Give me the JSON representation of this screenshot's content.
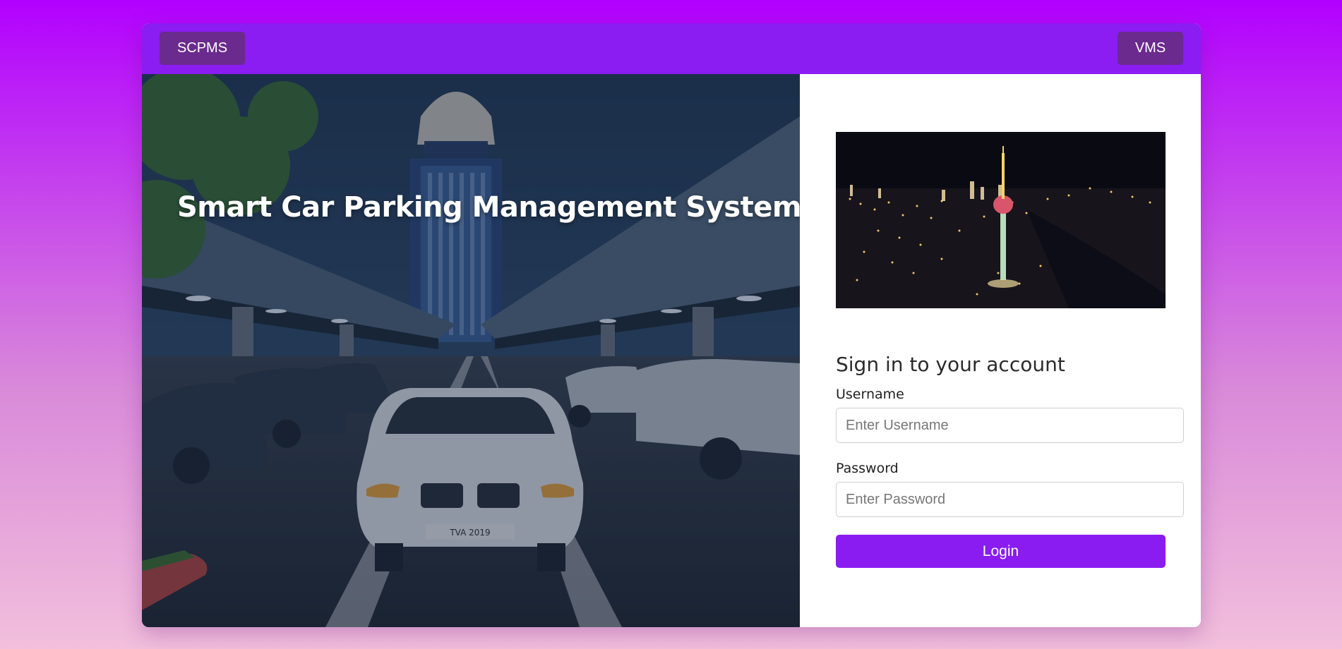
{
  "header": {
    "left_button": "SCPMS",
    "right_button": "VMS"
  },
  "hero": {
    "title": "Smart Car Parking Management System",
    "license_plate": "TVA 2019"
  },
  "login": {
    "title": "Sign in to your account",
    "username_label": "Username",
    "username_placeholder": "Enter Username",
    "username_value": "",
    "password_label": "Password",
    "password_placeholder": "Enter Password",
    "password_value": "",
    "submit_label": "Login"
  },
  "colors": {
    "page_gradient_top": "#b200ff",
    "page_gradient_bottom": "#f2bfdc",
    "header_bar": "#8b1cf2",
    "nav_button": "#6a2a8e",
    "login_button": "#8a1cf2"
  }
}
